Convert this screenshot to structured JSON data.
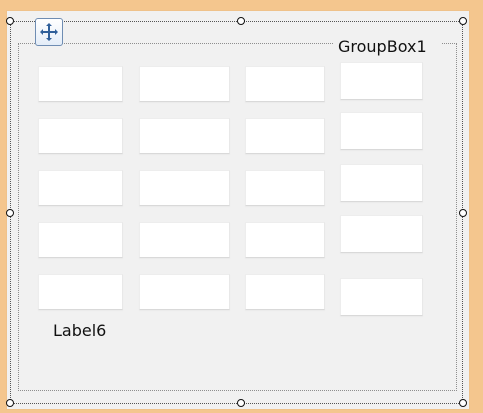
{
  "form": {
    "groupbox_title": "GroupBox1",
    "label_text": "Label6"
  },
  "icons": {
    "move": "move-icon",
    "selection_handle": "selection-handle"
  },
  "colors": {
    "outer_background": "#f4c68e",
    "surface_background": "#f1f1f1",
    "input_background": "#ffffff",
    "selection_border": "#555555",
    "handle_border": "#111111"
  }
}
